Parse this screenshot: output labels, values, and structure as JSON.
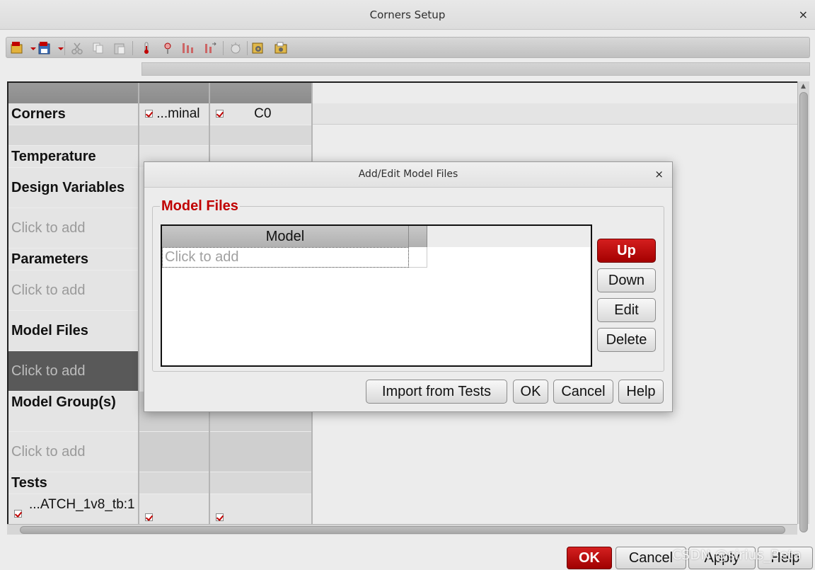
{
  "window": {
    "title": "Corners Setup",
    "close_glyph": "×"
  },
  "toolbar": {
    "icons": [
      "open-csv-icon",
      "save-csv-icon",
      "cut-icon",
      "copy-icon",
      "paste-icon",
      "temperature-icon",
      "variable-icon",
      "parameter-icon",
      "sweep-icon",
      "clear-icon",
      "settings-icon",
      "model-icon"
    ]
  },
  "grid": {
    "columns": [
      {
        "header": "",
        "checked": true,
        "name": "...minal"
      },
      {
        "header": "",
        "checked": true,
        "name": "C0"
      }
    ],
    "rows": {
      "corners": "Corners",
      "temperature": "Temperature",
      "design_variables": "Design Variables",
      "design_variables_hint": "Click to add",
      "parameters": "Parameters",
      "parameters_hint": "Click to add",
      "model_files": "Model Files",
      "model_files_hint": "Click to add",
      "model_groups": "Model Group(s)",
      "model_groups_hint": "Click to add",
      "tests": "Tests",
      "test_name": "...ATCH_1v8_tb:1"
    }
  },
  "bottom_buttons": {
    "ok": "OK",
    "cancel": "Cancel",
    "apply": "Apply",
    "help": "Help"
  },
  "watermark": "CSDN @sirius_Beta",
  "dialog": {
    "title": "Add/Edit Model Files",
    "close_glyph": "×",
    "group_label": "Model Files",
    "table": {
      "column_header": "Model",
      "placeholder": "Click to add"
    },
    "side_buttons": {
      "up": "Up",
      "down": "Down",
      "edit": "Edit",
      "delete": "Delete"
    },
    "footer_buttons": {
      "import": "Import from Tests",
      "ok": "OK",
      "cancel": "Cancel",
      "help": "Help"
    }
  },
  "colors": {
    "accent_red": "#c00000",
    "header_gray": "#8c8c8c",
    "selected_row": "#595959"
  }
}
